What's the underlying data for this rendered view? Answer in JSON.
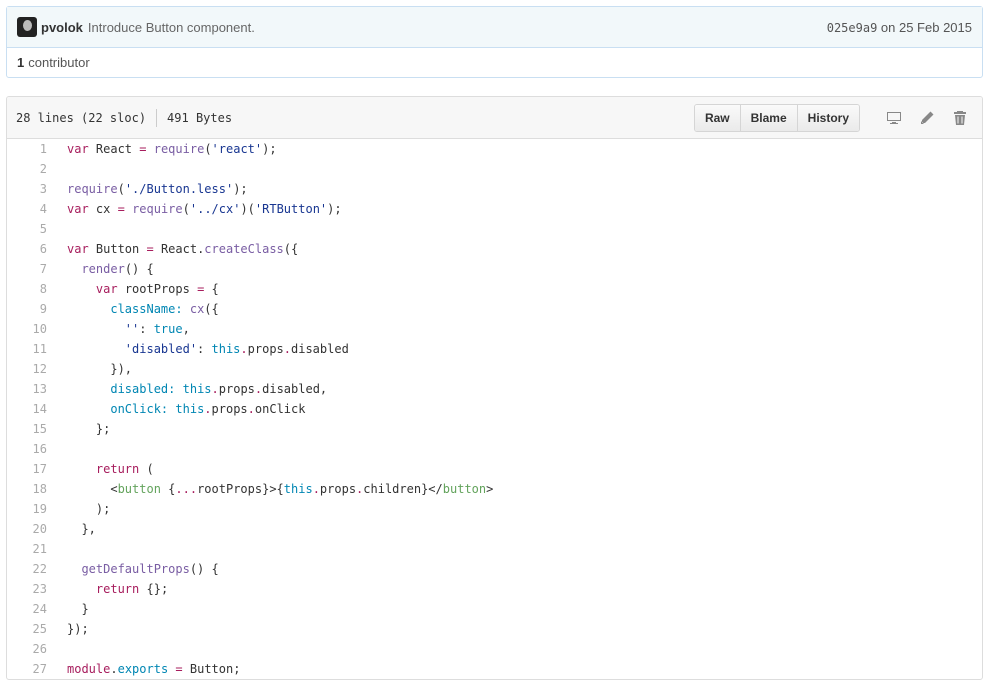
{
  "commit": {
    "author": "pvolok",
    "message": "Introduce Button component.",
    "sha": "025e9a9",
    "date_prefix": " on ",
    "date": "25 Feb 2015",
    "contributors_count": "1",
    "contributors_label": "contributor"
  },
  "file": {
    "lines_info": "28 lines (22 sloc)",
    "size": "491 Bytes",
    "buttons": {
      "raw": "Raw",
      "blame": "Blame",
      "history": "History"
    },
    "icons": [
      "desktop-icon",
      "pencil-icon",
      "trash-icon"
    ]
  },
  "code": {
    "line_numbers": [
      "1",
      "2",
      "3",
      "4",
      "5",
      "6",
      "7",
      "8",
      "9",
      "10",
      "11",
      "12",
      "13",
      "14",
      "15",
      "16",
      "17",
      "18",
      "19",
      "20",
      "21",
      "22",
      "23",
      "24",
      "25",
      "26",
      "27"
    ],
    "lines": [
      [
        [
          "k",
          "var"
        ],
        [
          "p",
          " React "
        ],
        [
          "k",
          "="
        ],
        [
          "p",
          " "
        ],
        [
          "f",
          "require"
        ],
        [
          "p",
          "("
        ],
        [
          "s",
          "'react'"
        ],
        [
          "p",
          ");"
        ]
      ],
      [],
      [
        [
          "f",
          "require"
        ],
        [
          "p",
          "("
        ],
        [
          "s",
          "'./Button.less'"
        ],
        [
          "p",
          ");"
        ]
      ],
      [
        [
          "k",
          "var"
        ],
        [
          "p",
          " cx "
        ],
        [
          "k",
          "="
        ],
        [
          "p",
          " "
        ],
        [
          "f",
          "require"
        ],
        [
          "p",
          "("
        ],
        [
          "s",
          "'../cx'"
        ],
        [
          "p",
          ")("
        ],
        [
          "s",
          "'RTButton'"
        ],
        [
          "p",
          ");"
        ]
      ],
      [],
      [
        [
          "k",
          "var"
        ],
        [
          "p",
          " Button "
        ],
        [
          "k",
          "="
        ],
        [
          "p",
          " React."
        ],
        [
          "f",
          "createClass"
        ],
        [
          "p",
          "({"
        ]
      ],
      [
        [
          "p",
          "  "
        ],
        [
          "f",
          "render"
        ],
        [
          "p",
          "() {"
        ]
      ],
      [
        [
          "p",
          "    "
        ],
        [
          "k",
          "var"
        ],
        [
          "p",
          " rootProps "
        ],
        [
          "k",
          "="
        ],
        [
          "p",
          " {"
        ]
      ],
      [
        [
          "p",
          "      "
        ],
        [
          "c",
          "className:"
        ],
        [
          "p",
          " "
        ],
        [
          "f",
          "cx"
        ],
        [
          "p",
          "({"
        ]
      ],
      [
        [
          "p",
          "        "
        ],
        [
          "s",
          "''"
        ],
        [
          "p",
          ": "
        ],
        [
          "c",
          "true"
        ],
        [
          "p",
          ","
        ]
      ],
      [
        [
          "p",
          "        "
        ],
        [
          "s",
          "'disabled'"
        ],
        [
          "p",
          ": "
        ],
        [
          "c",
          "this"
        ],
        [
          "k",
          "."
        ],
        [
          "p",
          "props"
        ],
        [
          "k",
          "."
        ],
        [
          "p",
          "disabled"
        ]
      ],
      [
        [
          "p",
          "      }),"
        ]
      ],
      [
        [
          "p",
          "      "
        ],
        [
          "c",
          "disabled:"
        ],
        [
          "p",
          " "
        ],
        [
          "c",
          "this"
        ],
        [
          "k",
          "."
        ],
        [
          "p",
          "props"
        ],
        [
          "k",
          "."
        ],
        [
          "p",
          "disabled,"
        ]
      ],
      [
        [
          "p",
          "      "
        ],
        [
          "c",
          "onClick:"
        ],
        [
          "p",
          " "
        ],
        [
          "c",
          "this"
        ],
        [
          "k",
          "."
        ],
        [
          "p",
          "props"
        ],
        [
          "k",
          "."
        ],
        [
          "p",
          "onClick"
        ]
      ],
      [
        [
          "p",
          "    };"
        ]
      ],
      [],
      [
        [
          "p",
          "    "
        ],
        [
          "k",
          "return"
        ],
        [
          "p",
          " ("
        ]
      ],
      [
        [
          "p",
          "      <"
        ],
        [
          "t",
          "button"
        ],
        [
          "p",
          " {"
        ],
        [
          "k",
          "..."
        ],
        [
          "p",
          "rootProps}>{"
        ],
        [
          "c",
          "this"
        ],
        [
          "k",
          "."
        ],
        [
          "p",
          "props"
        ],
        [
          "k",
          "."
        ],
        [
          "p",
          "children}</"
        ],
        [
          "t",
          "button"
        ],
        [
          "p",
          ">"
        ]
      ],
      [
        [
          "p",
          "    );"
        ]
      ],
      [
        [
          "p",
          "  },"
        ]
      ],
      [],
      [
        [
          "p",
          "  "
        ],
        [
          "f",
          "getDefaultProps"
        ],
        [
          "p",
          "() {"
        ]
      ],
      [
        [
          "p",
          "    "
        ],
        [
          "k",
          "return"
        ],
        [
          "p",
          " {};"
        ]
      ],
      [
        [
          "p",
          "  }"
        ]
      ],
      [
        [
          "p",
          "});"
        ]
      ],
      [],
      [
        [
          "k",
          "module"
        ],
        [
          "p",
          "."
        ],
        [
          "c",
          "exports"
        ],
        [
          "p",
          " "
        ],
        [
          "k",
          "="
        ],
        [
          "p",
          " Button;"
        ]
      ]
    ]
  }
}
